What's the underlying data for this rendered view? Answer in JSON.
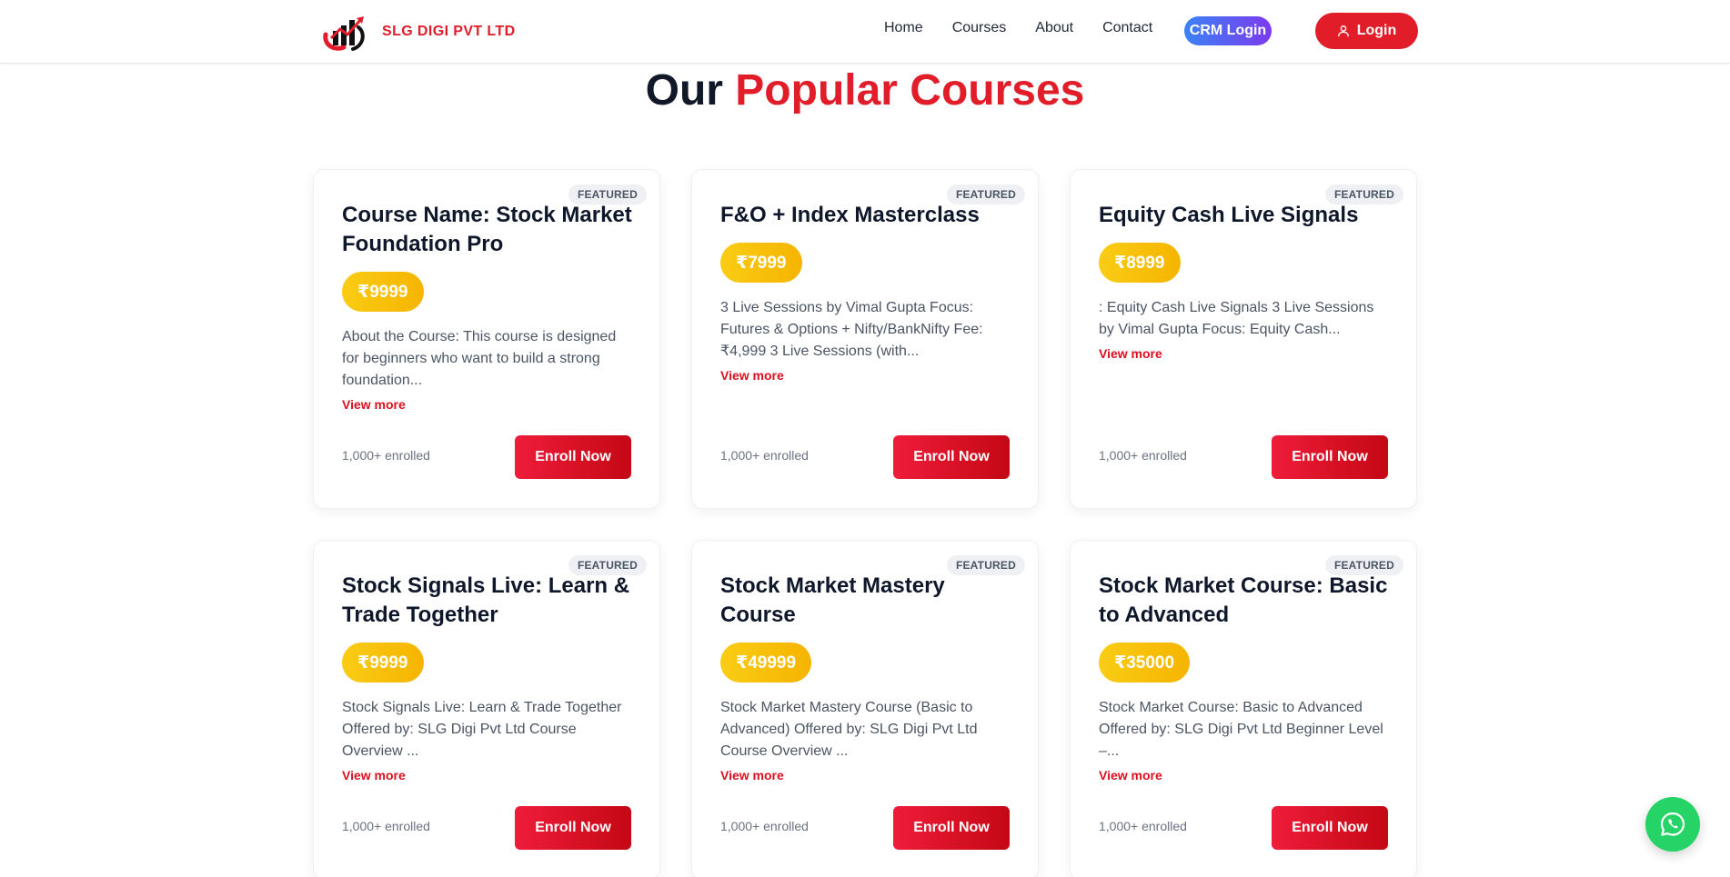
{
  "brand": {
    "name": "SLG DIGI PVT LTD"
  },
  "nav": {
    "items": [
      {
        "label": "Home"
      },
      {
        "label": "Courses"
      },
      {
        "label": "About"
      },
      {
        "label": "Contact"
      }
    ],
    "crm_label": "CRM Login",
    "login_label": "Login"
  },
  "section": {
    "title_part1": "Our ",
    "title_part2": "Popular Courses"
  },
  "courses": [
    {
      "badge": "FEATURED",
      "title": "Course Name: Stock Market Foundation Pro",
      "price": "₹9999",
      "description": "About the Course: This course is designed for beginners who want to build a strong foundation...",
      "view_more": "View more",
      "enrolled": "1,000+ enrolled",
      "enroll_label": "Enroll Now"
    },
    {
      "badge": "FEATURED",
      "title": "F&O + Index Masterclass",
      "price": "₹7999",
      "description": "3 Live Sessions by Vimal Gupta Focus: Futures & Options + Nifty/BankNifty Fee: ₹4,999 3 Live Sessions (with...",
      "view_more": "View more",
      "enrolled": "1,000+ enrolled",
      "enroll_label": "Enroll Now"
    },
    {
      "badge": "FEATURED",
      "title": "Equity Cash Live Signals",
      "price": "₹8999",
      "description": ": Equity Cash Live Signals 3 Live Sessions by Vimal Gupta Focus: Equity Cash...",
      "view_more": "View more",
      "enrolled": "1,000+ enrolled",
      "enroll_label": "Enroll Now"
    },
    {
      "badge": "FEATURED",
      "title": "Stock Signals Live: Learn & Trade Together",
      "price": "₹9999",
      "description": "Stock Signals Live: Learn & Trade Together Offered by: SLG Digi Pvt Ltd Course Overview ...",
      "view_more": "View more",
      "enrolled": "1,000+ enrolled",
      "enroll_label": "Enroll Now"
    },
    {
      "badge": "FEATURED",
      "title": "Stock Market Mastery Course",
      "price": "₹49999",
      "description": "Stock Market Mastery Course (Basic to Advanced) Offered by: SLG Digi Pvt Ltd Course Overview ...",
      "view_more": "View more",
      "enrolled": "1,000+ enrolled",
      "enroll_label": "Enroll Now"
    },
    {
      "badge": "FEATURED",
      "title": "Stock Market Course: Basic to Advanced",
      "price": "₹35000",
      "description": "Stock Market Course: Basic to Advanced Offered by: SLG Digi Pvt Ltd Beginner Level –...",
      "view_more": "View more",
      "enrolled": "1,000+ enrolled",
      "enroll_label": "Enroll Now"
    }
  ],
  "icons": {
    "logo": "stock-chart-logo-icon",
    "login": "user-icon",
    "whatsapp": "whatsapp-icon"
  },
  "colors": {
    "brand_red": "#e11d2a",
    "price_gold": "#f5b400",
    "crm_gradient_start": "#3b82f6",
    "crm_gradient_end": "#7c3aed",
    "whatsapp_green": "#25d366"
  }
}
